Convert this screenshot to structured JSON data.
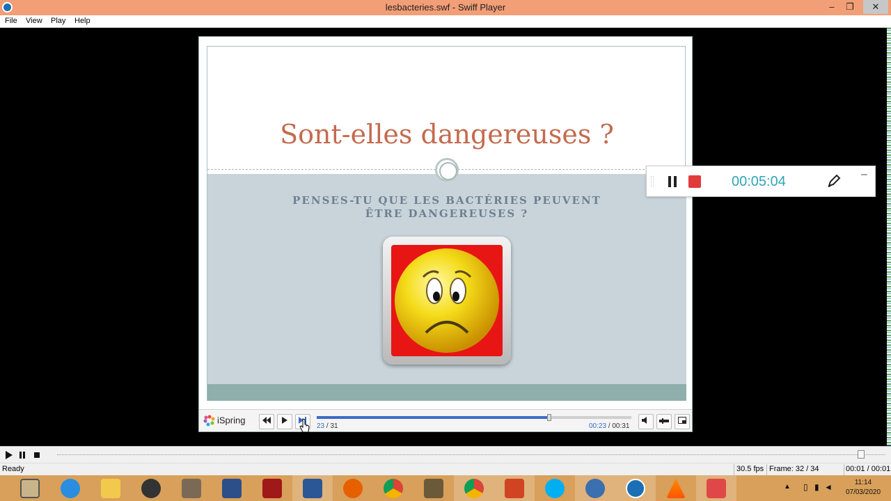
{
  "window": {
    "title": "lesbacteries.swf - Swiff Player",
    "min_glyph": "–",
    "max_glyph": "❐",
    "close_glyph": "✕"
  },
  "menu": [
    "File",
    "View",
    "Play",
    "Help"
  ],
  "slide": {
    "title": "Sont-elles dangereuses ?",
    "question_line1": "PENSES-TU QUE LES BACTÉRIES PEUVENT",
    "question_line2": "ÊTRE DANGEREUSES ?"
  },
  "ispring": {
    "logo_text": "iSpring",
    "slide_current": "23",
    "slide_total": "/ 31",
    "time_current": "00:23",
    "time_total": "/ 00:31",
    "progress_fraction": 0.74
  },
  "recorder": {
    "timer": "00:05:04",
    "minimize_glyph": "–"
  },
  "statusbar": {
    "status": "Ready",
    "fps": "30.5 fps",
    "frame": "Frame: 32 / 34",
    "time": "00:01 / 00:01"
  },
  "taskbar": {
    "clock_time": "11:14",
    "clock_date": "07/03/2020",
    "icons": [
      "app-grey-icon",
      "internet-explorer-icon",
      "file-explorer-icon",
      "speaker-app-icon",
      "doc-app-icon",
      "settings-app-icon",
      "power-app-icon",
      "word-icon",
      "firefox-icon",
      "chrome-icon",
      "slides-app-icon",
      "chrome-icon",
      "powerpoint-icon",
      "skype-icon",
      "sync-app-icon",
      "swiff-player-icon",
      "vlc-icon",
      "screen-recorder-icon"
    ]
  },
  "colors": {
    "titlebar": "#f29e76",
    "slide_title": "#c46a4e",
    "timer": "#2fa5b8",
    "taskbar": "#d8a05a"
  }
}
